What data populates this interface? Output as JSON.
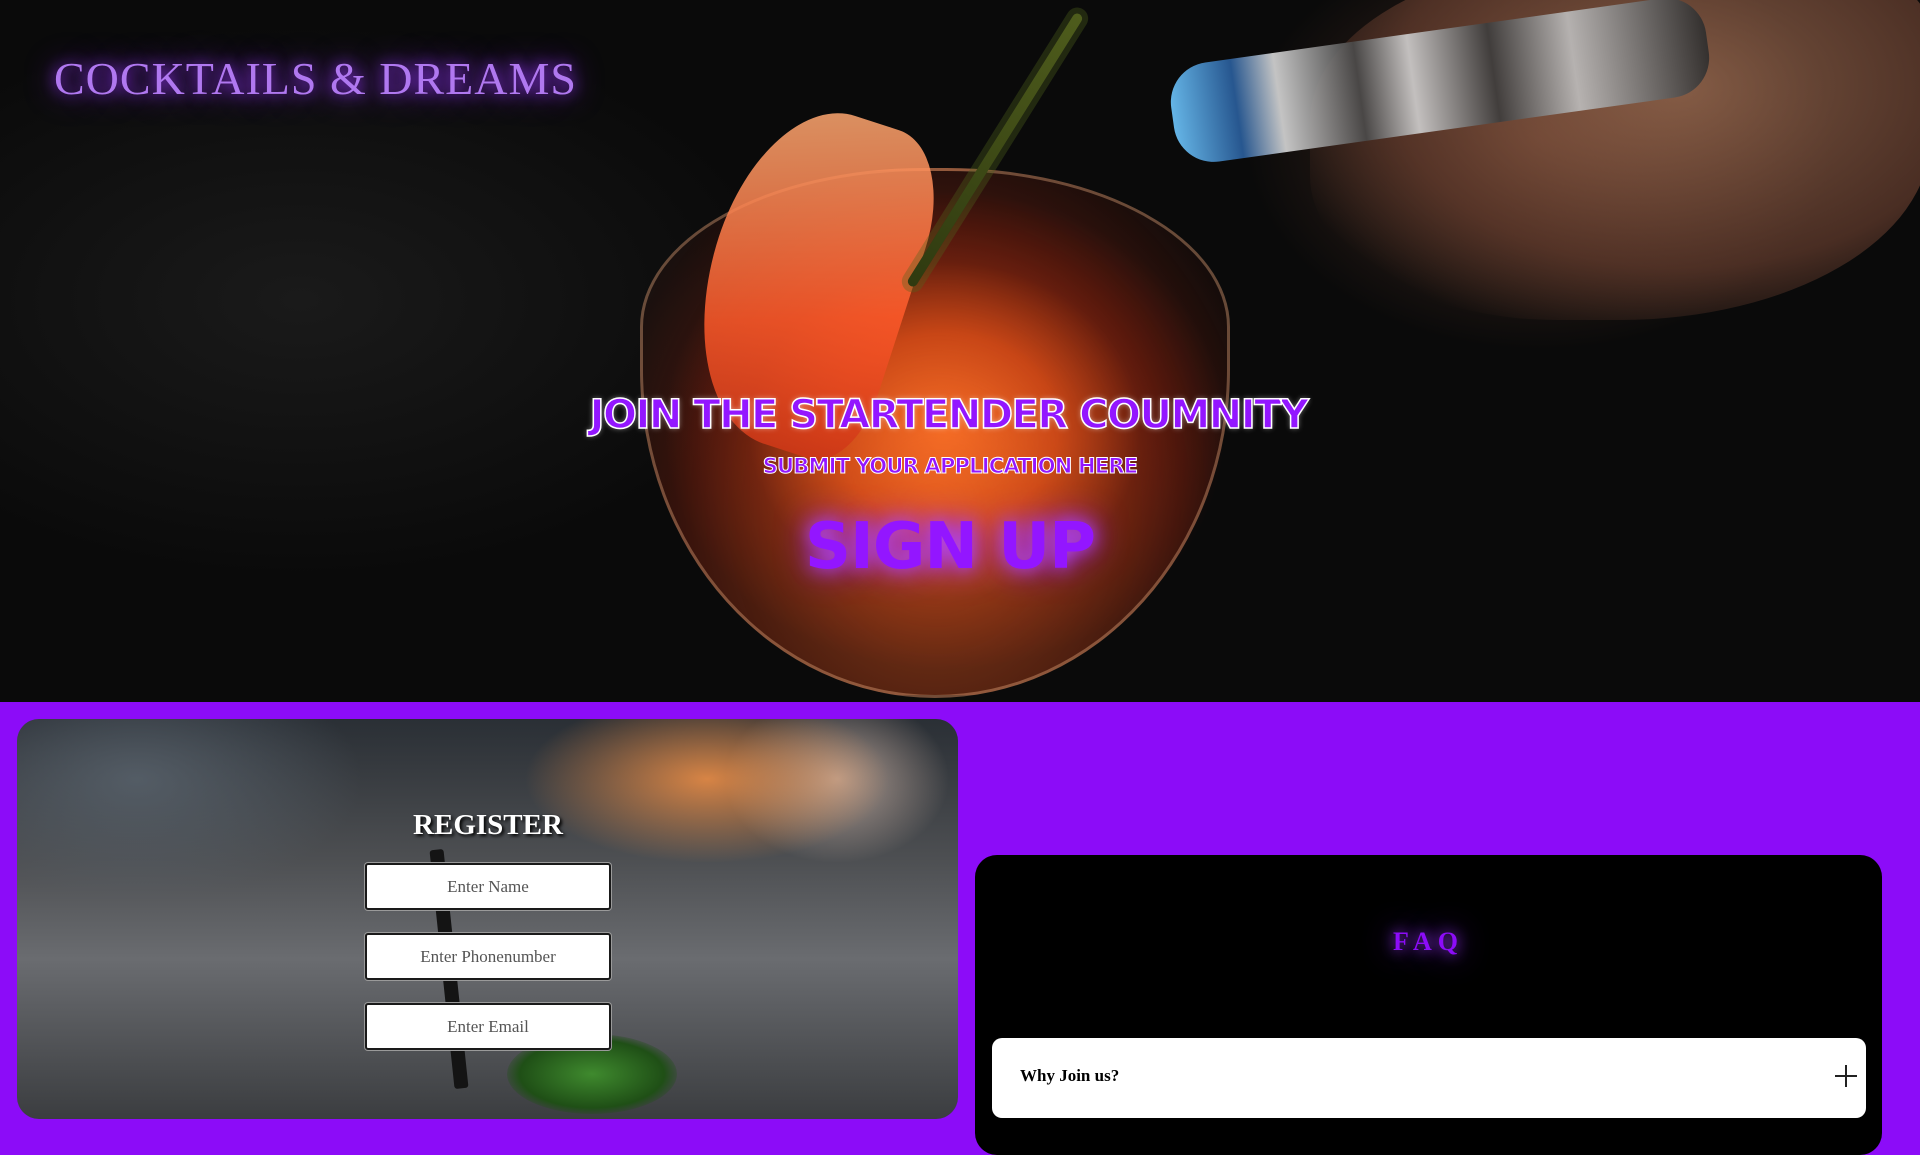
{
  "header": {
    "brand": "COCKTAILS & DREAMS"
  },
  "hero": {
    "headline": "JOIN THE STARTENDER COUMNITY",
    "subline": "SUBMIT YOUR APPLICATION HERE",
    "cta_label": "SIGN UP"
  },
  "register": {
    "title": "REGISTER",
    "name_placeholder": "Enter Name",
    "phone_placeholder": "Enter Phonenumber",
    "email_placeholder": "Enter Email"
  },
  "faq": {
    "title": "FAQ",
    "items": [
      {
        "question": "Why Join us?",
        "icon": "plus-icon"
      }
    ]
  },
  "colors": {
    "accent": "#8c0cf8",
    "brand_glow": "#b078f0",
    "panel_dark": "#000000"
  }
}
